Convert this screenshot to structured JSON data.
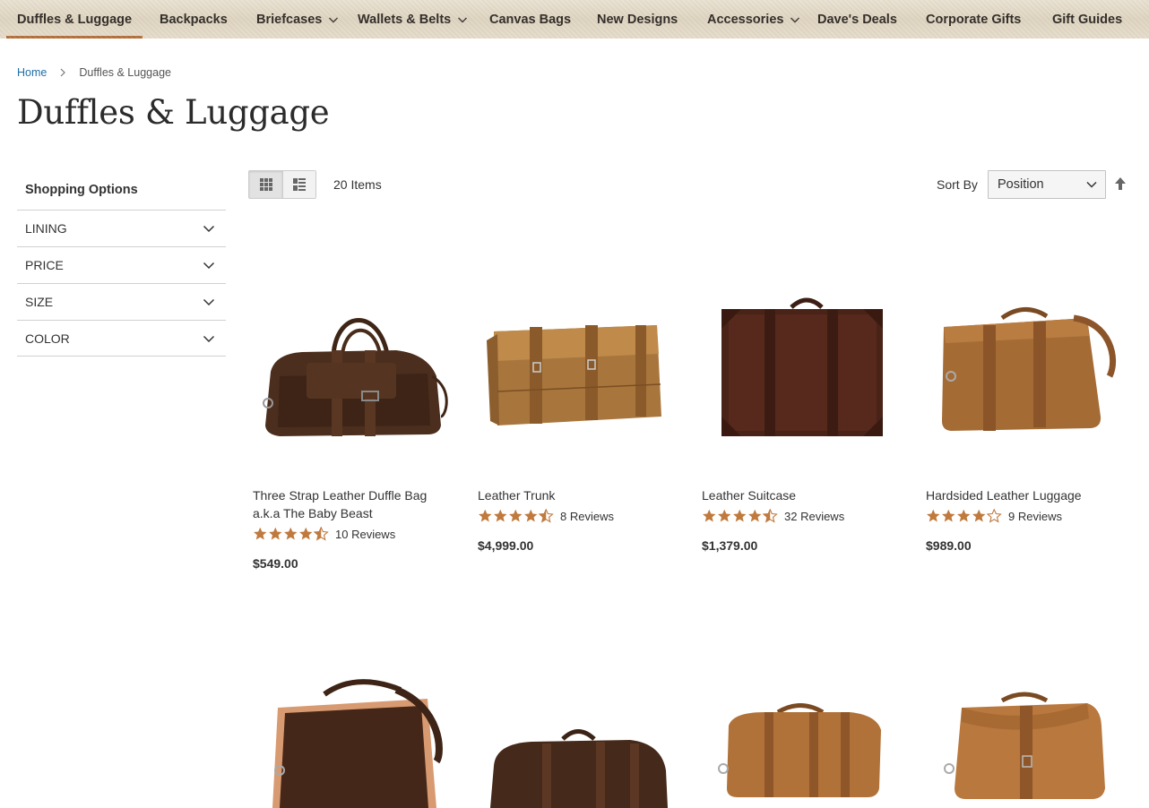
{
  "nav": {
    "items": [
      {
        "label": "Duffles & Luggage",
        "dropdown": false,
        "active": true
      },
      {
        "label": "Backpacks",
        "dropdown": false
      },
      {
        "label": "Briefcases",
        "dropdown": true
      },
      {
        "label": "Wallets & Belts",
        "dropdown": true
      },
      {
        "label": "Canvas Bags",
        "dropdown": false
      },
      {
        "label": "New Designs",
        "dropdown": false
      },
      {
        "label": "Accessories",
        "dropdown": true
      },
      {
        "label": "Dave's Deals",
        "dropdown": false
      },
      {
        "label": "Corporate Gifts",
        "dropdown": false
      },
      {
        "label": "Gift Guides",
        "dropdown": false
      }
    ],
    "accent_color": "#b5703a"
  },
  "breadcrumb": {
    "home": "Home",
    "current": "Duffles & Luggage"
  },
  "page_title": "Duffles & Luggage",
  "sidebar": {
    "title": "Shopping Options",
    "filters": [
      "LINING",
      "PRICE",
      "SIZE",
      "COLOR"
    ]
  },
  "toolbar": {
    "view_modes": [
      "grid-icon",
      "list-icon"
    ],
    "active_mode": "grid",
    "amount": "20 Items",
    "sort_label": "Sort By",
    "sort_value": "Position"
  },
  "products": [
    {
      "name": "Three Strap Leather Duffle Bag a.k.a The Baby Beast",
      "rating": 4.5,
      "reviews": "10 Reviews",
      "price": "$549.00"
    },
    {
      "name": "Leather Trunk",
      "rating": 4.5,
      "reviews": "8 Reviews",
      "price": "$4,999.00"
    },
    {
      "name": "Leather Suitcase",
      "rating": 4.5,
      "reviews": "32 Reviews",
      "price": "$1,379.00"
    },
    {
      "name": "Hardsided Leather Luggage",
      "rating": 4,
      "reviews": "9 Reviews",
      "price": "$989.00"
    }
  ],
  "star_color": "#c07a3e"
}
